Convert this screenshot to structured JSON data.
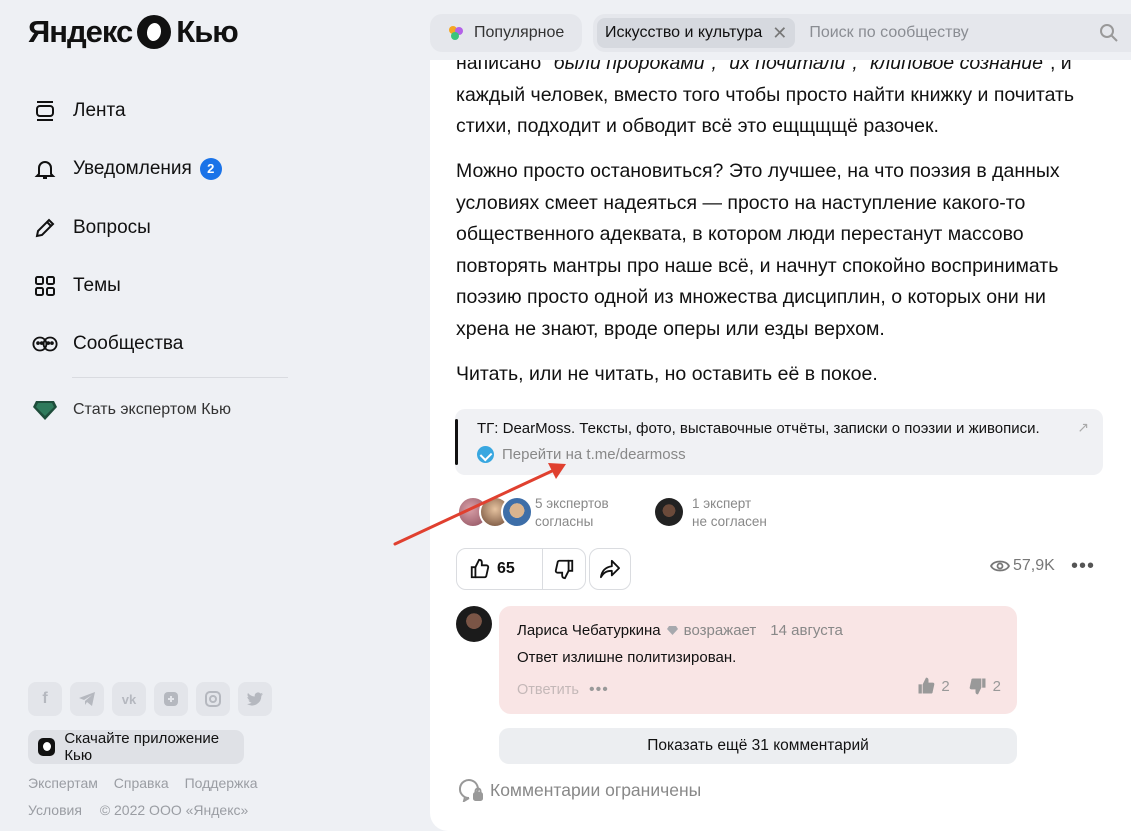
{
  "header": {
    "logo_left": "Яндекс",
    "logo_right": "Кью",
    "popular_label": "Популярное",
    "community_chip": "Искусство и культура",
    "search_placeholder": "Поиск по сообществу"
  },
  "sidebar": {
    "items": [
      {
        "label": "Лента",
        "icon": "feed-icon"
      },
      {
        "label": "Уведомления",
        "icon": "bell-icon",
        "badge": "2"
      },
      {
        "label": "Вопросы",
        "icon": "pencil-icon"
      },
      {
        "label": "Темы",
        "icon": "grid-icon"
      },
      {
        "label": "Сообщества",
        "icon": "community-icon"
      }
    ],
    "expert_link": "Стать экспертом Кью",
    "socials": [
      "f",
      "telegram",
      "vk",
      "ok",
      "instagram",
      "twitter"
    ],
    "app_button": "Скачайте приложение Кью",
    "footer_links": [
      "Экспертам",
      "Справка",
      "Поддержка"
    ],
    "footer_row2": [
      "Условия",
      "© 2022 ООО «Яндекс»"
    ]
  },
  "answer": {
    "para1_a": "написано ",
    "para1_b": "\"были пророками\", \"их почитали\", \"клиповое сознание\"",
    "para1_c": ", и каждый человек, вместо того чтобы просто найти книжку и почитать стихи, подходит и обводит всё это ещщщщё разочек.",
    "para2": "Можно просто остановиться? Это лучшее, на что поэзия в данных условиях смеет надеяться — просто на наступление какого-то общественного адеквата, в котором люди перестанут массово повторять мантры про наше всё, и начнут спокойно воспринимать поэзию просто одной из множества дисциплин, о которых они ни хрена не знают, вроде оперы или езды верхом.",
    "para3": "Читать, или не читать, но оставить её в покое.",
    "tg_title": "ТГ: DearMoss. Тексты, фото, выставочные отчёты, записки о поэзии и живописи.",
    "tg_link": "Перейти на t.me/dearmoss",
    "agree_line1": "5 экспертов",
    "agree_line2": "согласны",
    "disagree_line1": "1 эксперт",
    "disagree_line2": "не согласен",
    "likes": "65",
    "views": "57,9K"
  },
  "comment": {
    "author": "Лариса Чебатуркина",
    "role": "возражает",
    "date": "14 августа",
    "text": "Ответ излишне политизирован.",
    "reply": "Ответить",
    "likes": "2",
    "dislikes": "2"
  },
  "show_more": "Показать ещё 31 комментарий",
  "comments_limited": "Комментарии ограничены",
  "colors": {
    "accent_blue": "#1a73e8",
    "telegram": "#38a7e0",
    "annotation_arrow": "#e0402f",
    "comment_bg": "#f9e5e5"
  }
}
